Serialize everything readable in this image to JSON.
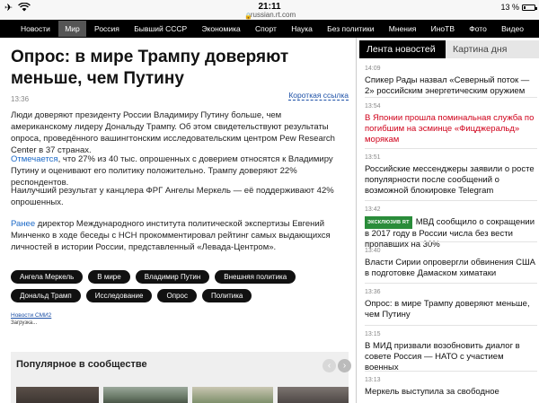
{
  "status_bar": {
    "time": "21:11",
    "url": "russian.rt.com",
    "battery": "13 %",
    "battery_level": 0.13
  },
  "nav": {
    "items": [
      {
        "label": "Новости",
        "active": false
      },
      {
        "label": "Мир",
        "active": true
      },
      {
        "label": "Россия",
        "active": false
      },
      {
        "label": "Бывший СССР",
        "active": false
      },
      {
        "label": "Экономика",
        "active": false
      },
      {
        "label": "Спорт",
        "active": false
      },
      {
        "label": "Наука",
        "active": false
      },
      {
        "label": "Без политики",
        "active": false
      },
      {
        "label": "Мнения",
        "active": false
      },
      {
        "label": "ИноТВ",
        "active": false
      },
      {
        "label": "Фото",
        "active": false
      },
      {
        "label": "Видео",
        "active": false
      }
    ]
  },
  "article": {
    "headline": "Опрос: в мире Трампу доверяют меньше, чем Путину",
    "timestamp": "13:36",
    "short_link": "Короткая ссылка",
    "p1": "Люди доверяют президенту России Владимиру Путину больше, чем американскому лидеру Дональду Трампу. Об этом свидетельствуют результаты опроса, проведённого вашингтонским исследовательским центром Pew Research Center в 37 странах.",
    "p2_link": "Отмечается",
    "p2_rest": ", что 27% из 40 тыс. опрошенных с доверием относятся к Владимиру Путину и оценивают его политику положительно. Трампу доверяют 22% респондентов.",
    "p3": "Наилучший результат у канцлера ФРГ Ангелы Меркель — её поддерживают 42% опрошенных.",
    "p4_link": "Ранее",
    "p4_rest": " директор Международного института политической экспертизы Евгений Минченко в ходе беседы с НСН прокомментировал рейтинг самых выдающихся личностей в истории России, представленный «Левада-Центром».",
    "tags": [
      "Ангела Меркель",
      "В мире",
      "Владимир Путин",
      "Внешняя политика",
      "Дональд Трамп",
      "Исследование",
      "Опрос",
      "Политика"
    ],
    "smi_link": "Новости СМИ2",
    "loading": "Загрузка...",
    "popular_title": "Популярное в сообществе"
  },
  "sidebar": {
    "tab_active": "Лента новостей",
    "tab_inactive": "Картина дня",
    "exclusive_label": "ЭКСКЛЮЗИВ RT",
    "news": [
      {
        "time": "14:09",
        "text": "Спикер Рады назвал «Северный поток — 2» российским энергетическим оружием",
        "red": false
      },
      {
        "time": "13:54",
        "text": "В Японии прошла поминальная служба по погибшим на эсминце «Фицджеральд» морякам",
        "red": true
      },
      {
        "time": "13:51",
        "text": "Российские мессенджеры заявили о росте популярности после сообщений о возможной блокировке Telegram",
        "red": false
      },
      {
        "time": "13:42",
        "text": "МВД сообщило о сокращении в 2017 году в России числа без вести пропавших на 30%",
        "red": false
      },
      {
        "time": "13:40",
        "text": "Власти Сирии опровергли обвинения США в подготовке Дамаском химатаки",
        "red": false
      },
      {
        "time": "13:36",
        "text": "Опрос: в мире Трампу доверяют меньше, чем Путину",
        "red": false
      },
      {
        "time": "13:15",
        "text": "В МИД призвали возобновить диалог в совете Россия — НАТО с участием военных",
        "red": false
      },
      {
        "time": "13:13",
        "text": "Меркель выступила за свободное",
        "red": false
      }
    ]
  }
}
